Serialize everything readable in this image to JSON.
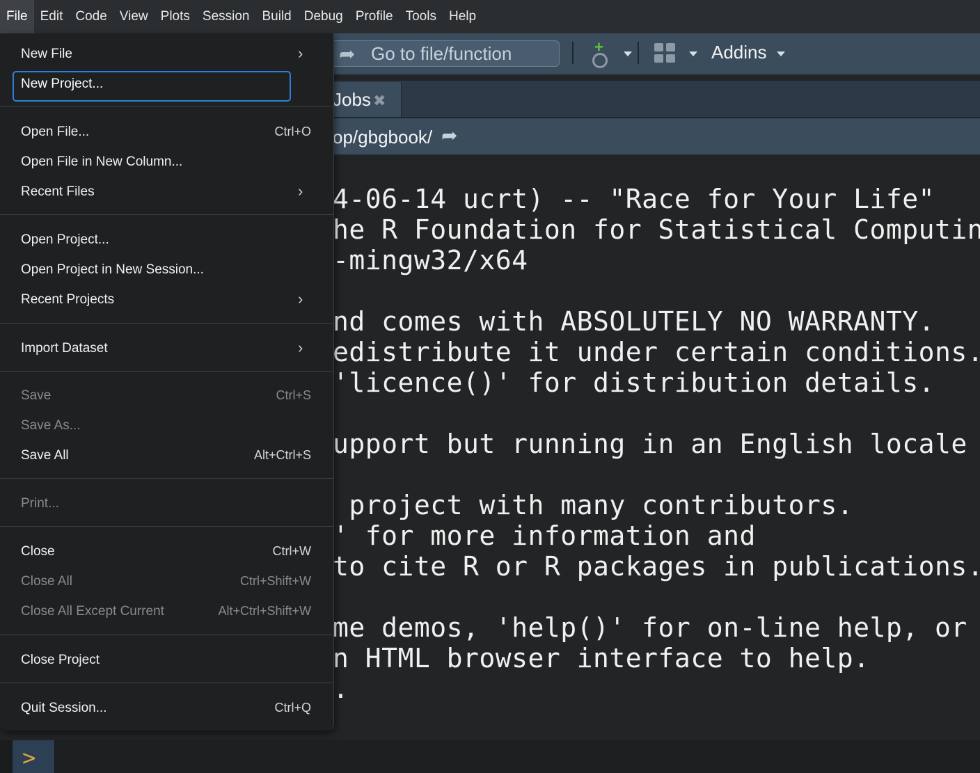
{
  "menubar": {
    "items": [
      "File",
      "Edit",
      "Code",
      "View",
      "Plots",
      "Session",
      "Build",
      "Debug",
      "Profile",
      "Tools",
      "Help"
    ]
  },
  "toolbar": {
    "goto_placeholder": "Go to file/function",
    "addins_label": "Addins",
    "icons": [
      "goto-arrow-icon",
      "vcs-add-icon",
      "workspace-panes-icon"
    ]
  },
  "tabs": {
    "jobs_label": "Jobs",
    "close_icon": "close-icon"
  },
  "path": {
    "text": "op/gbgbook/",
    "icon": "go-to-directory-icon"
  },
  "console": {
    "lines": [
      "4-06-14 ucrt) -- \"Race for Your Life\"",
      "he R Foundation for Statistical Computing",
      "-mingw32/x64",
      "",
      "nd comes with ABSOLUTELY NO WARRANTY.",
      "edistribute it under certain conditions.",
      "'licence()' for distribution details.",
      "",
      "upport but running in an English locale",
      "",
      " project with many contributors.",
      "' for more information and",
      "to cite R or R packages in publications.",
      "",
      "me demos, 'help()' for on-line help, or",
      "n HTML browser interface to help.",
      "."
    ],
    "prompt": ">"
  },
  "file_menu": {
    "new_file": "New File",
    "new_project": "New Project...",
    "open_file": "Open File...",
    "open_file_sc": "Ctrl+O",
    "open_file_new_column": "Open File in New Column...",
    "recent_files": "Recent Files",
    "open_project": "Open Project...",
    "open_project_new_session": "Open Project in New Session...",
    "recent_projects": "Recent Projects",
    "import_dataset": "Import Dataset",
    "save": "Save",
    "save_sc": "Ctrl+S",
    "save_as": "Save As...",
    "save_all": "Save All",
    "save_all_sc": "Alt+Ctrl+S",
    "print": "Print...",
    "close": "Close",
    "close_sc": "Ctrl+W",
    "close_all": "Close All",
    "close_all_sc": "Ctrl+Shift+W",
    "close_all_except": "Close All Except Current",
    "close_all_except_sc": "Alt+Ctrl+Shift+W",
    "close_project": "Close Project",
    "quit_session": "Quit Session...",
    "quit_session_sc": "Ctrl+Q"
  }
}
